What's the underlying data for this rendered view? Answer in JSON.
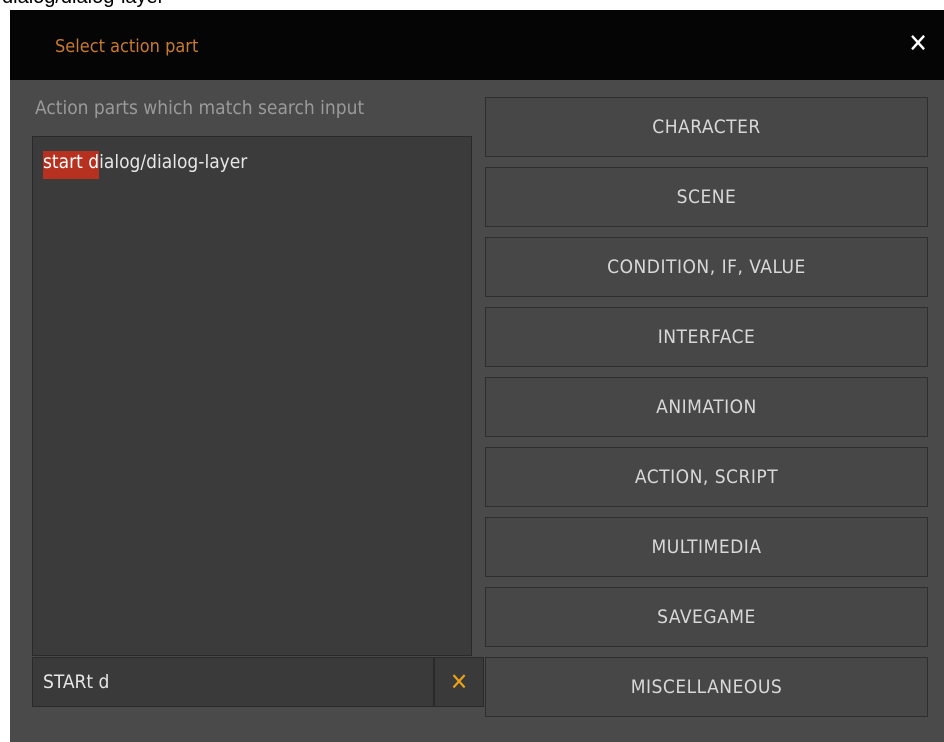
{
  "background_caption": "dialog/dialog-layer",
  "dialog": {
    "title": "Select action part",
    "close_icon": "close-icon",
    "colors": {
      "title_text": "#c97a2c",
      "titlebar_bg": "#050505",
      "panel_bg": "#4a4a4a",
      "match_highlight": "#b6311f",
      "clear_icon": "#e8a21a"
    }
  },
  "results": {
    "caption": "Action parts which match search input",
    "items": [
      {
        "match": "start d",
        "rest": "ialog/dialog-layer"
      }
    ]
  },
  "search": {
    "value": "STARt d",
    "clear_icon": "clear-x-icon"
  },
  "categories": [
    "CHARACTER",
    "SCENE",
    "CONDITION, IF, VALUE",
    "INTERFACE",
    "ANIMATION",
    "ACTION, SCRIPT",
    "MULTIMEDIA",
    "SAVEGAME",
    "MISCELLANEOUS"
  ]
}
